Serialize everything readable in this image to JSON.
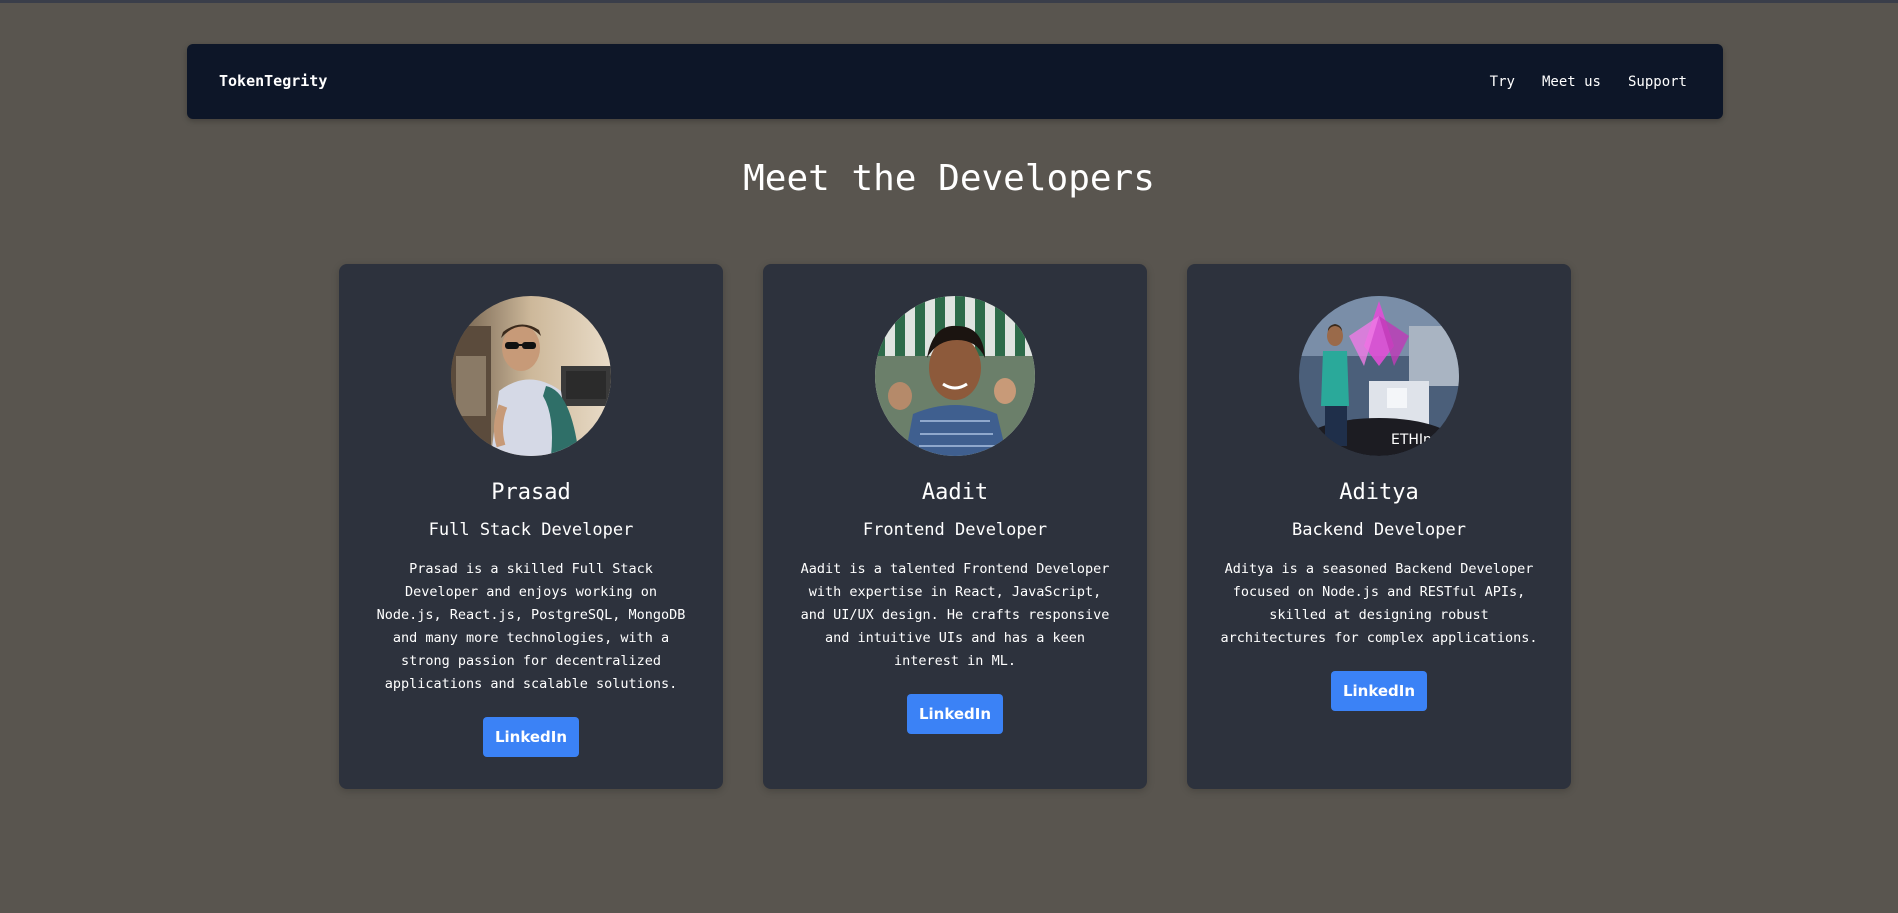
{
  "navbar": {
    "brand": "TokenTegrity",
    "links": [
      {
        "label": "Try"
      },
      {
        "label": "Meet us"
      },
      {
        "label": "Support"
      }
    ]
  },
  "page": {
    "title": "Meet the Developers"
  },
  "developers": [
    {
      "name": "Prasad",
      "role": "Full Stack Developer",
      "bio": "Prasad is a skilled Full Stack Developer and enjoys working on Node.js, React.js, PostgreSQL, MongoDB and many more technologies, with a strong passion for decentralized applications and scalable solutions.",
      "button": "LinkedIn"
    },
    {
      "name": "Aadit",
      "role": "Frontend Developer",
      "bio": "Aadit is a talented Frontend Developer with expertise in React, JavaScript, and UI/UX design. He crafts responsive and intuitive UIs and has a keen interest in ML.",
      "button": "LinkedIn"
    },
    {
      "name": "Aditya",
      "role": "Backend Developer",
      "bio": "Aditya is a seasoned Backend Developer focused on Node.js and RESTful APIs, skilled at designing robust architectures for complex applications.",
      "button": "LinkedIn",
      "photo_sign": "ETHIndia"
    }
  ],
  "colors": {
    "page_bg": "#59554f",
    "navbar_bg": "#0d1628",
    "card_bg": "#2d323d",
    "button_bg": "#3b82f6",
    "text": "#ffffff"
  }
}
